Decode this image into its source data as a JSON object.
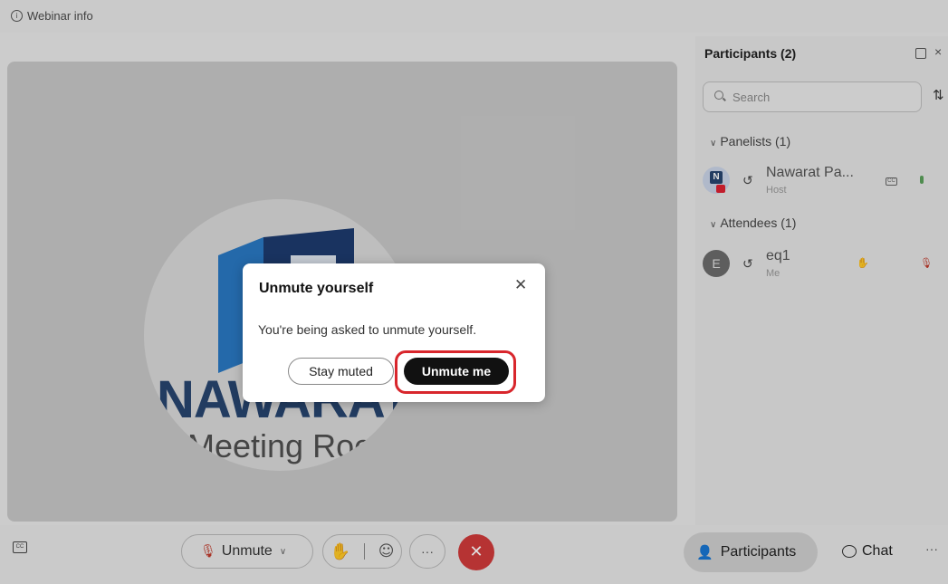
{
  "header": {
    "webinar_info": "Webinar info"
  },
  "stage": {
    "brand_text": "NAWARAT",
    "subtitle": "Meeting Room"
  },
  "panel": {
    "title": "Participants (2)",
    "search_placeholder": "Search",
    "panelists_header": "Panelists (1)",
    "attendees_header": "Attendees (1)",
    "panelists": [
      {
        "name": "Nawarat Pa...",
        "role": "Host"
      }
    ],
    "attendees": [
      {
        "initial": "E",
        "name": "eq1",
        "role": "Me"
      }
    ]
  },
  "toolbar": {
    "unmute_label": "Unmute",
    "more_label": "···",
    "participants_label": "Participants",
    "chat_label": "Chat",
    "more_right": "···"
  },
  "dialog": {
    "title": "Unmute yourself",
    "message": "You're being asked to unmute yourself.",
    "stay_muted": "Stay muted",
    "unmute_me": "Unmute me"
  },
  "colors": {
    "leave_button": "#d03b3b",
    "primary_button": "#111111",
    "highlight": "#d8262c",
    "muted_mic": "#c0392b"
  },
  "icons": [
    "info-icon",
    "search-icon",
    "sort-icon",
    "headset-icon",
    "mic-muted-icon",
    "raise-hand-icon",
    "emoji-icon",
    "close-icon",
    "people-icon",
    "chat-icon",
    "popout-icon"
  ]
}
